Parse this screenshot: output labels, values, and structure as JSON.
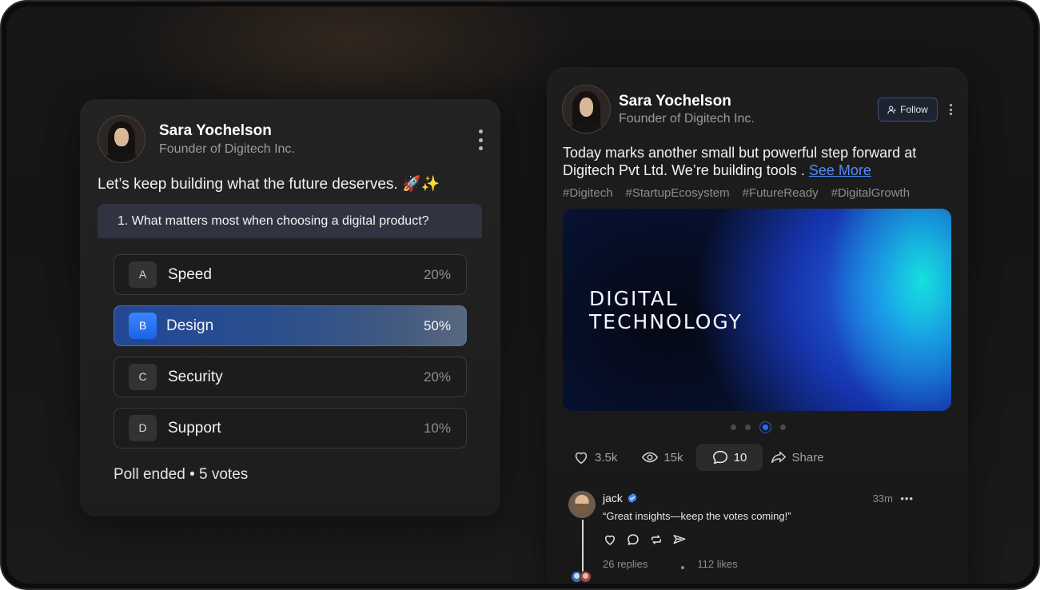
{
  "poll_card": {
    "author_name": "Sara Yochelson",
    "author_role": "Founder of Digitech Inc.",
    "post_text": "Let’s keep building what the future deserves. 🚀✨",
    "question": "1.  What matters most when choosing a digital product?",
    "options": [
      {
        "letter": "A",
        "label": "Speed",
        "percent": "20%",
        "selected": false
      },
      {
        "letter": "B",
        "label": "Design",
        "percent": "50%",
        "selected": true
      },
      {
        "letter": "C",
        "label": "Security",
        "percent": "20%",
        "selected": false
      },
      {
        "letter": "D",
        "label": "Support",
        "percent": "10%",
        "selected": false
      }
    ],
    "footer": "Poll ended • 5 votes"
  },
  "post_card": {
    "author_name": "Sara Yochelson",
    "author_role": "Founder of Digitech Inc.",
    "follow_label": "Follow",
    "body_text": "Today marks another small but powerful step forward at Digitech Pvt Ltd. We’re building tools . ",
    "see_more_label": "See More",
    "tags": [
      "#Digitech",
      "#StartupEcosystem",
      "#FutureReady",
      "#DigitalGrowth"
    ],
    "image_title_line1": "DIGITAL",
    "image_title_line2": "TECHNOLOGY",
    "carousel": {
      "count": 4,
      "active_index": 2
    },
    "actions": {
      "likes": "3.5k",
      "views": "15k",
      "comments": "10",
      "share_label": "Share"
    },
    "comment": {
      "author": "jack",
      "verified": true,
      "time": "33m",
      "more": "•••",
      "text": "“Great insights—keep the votes coming!”",
      "replies": "26 replies",
      "likes": "112 likes"
    }
  },
  "colors": {
    "accent": "#2f6bff",
    "link": "#4f8bff",
    "verified": "#3b8bff"
  },
  "icons": {
    "like": "heart-icon",
    "views": "eye-icon",
    "comments": "speech-bubble-icon",
    "share": "share-arrow-icon",
    "follow": "person-plus-icon",
    "repost": "repost-icon",
    "send": "send-icon",
    "verified": "verified-badge-icon"
  }
}
